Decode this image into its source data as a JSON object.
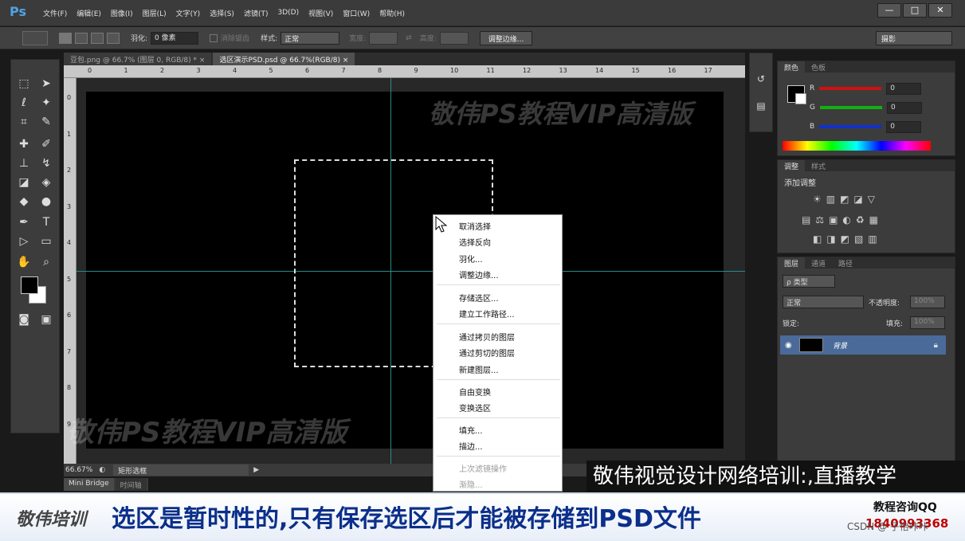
{
  "app": {
    "logo": "Ps",
    "menu": [
      "文件(F)",
      "编辑(E)",
      "图像(I)",
      "图层(L)",
      "文字(Y)",
      "选择(S)",
      "滤镜(T)",
      "3D(D)",
      "视图(V)",
      "窗口(W)",
      "帮助(H)"
    ],
    "window_controls": [
      "—",
      "□",
      "✕"
    ]
  },
  "options": {
    "feather_label": "羽化:",
    "feather_value": "0 像素",
    "antialias_label": "消除锯齿",
    "style_label": "样式:",
    "style_value": "正常",
    "width_label": "宽度:",
    "height_label": "高度:",
    "refine_button": "调整边缘...",
    "workspace": "摄影"
  },
  "tabs": [
    {
      "label": "豆包.png @ 66.7% (图层 0, RGB/8) *",
      "close": "×"
    },
    {
      "label": "选区演示PSD.psd @ 66.7%(RGB/8)",
      "close": "×"
    }
  ],
  "ruler": {
    "top": [
      "0",
      "1",
      "2",
      "3",
      "4",
      "5",
      "6",
      "7",
      "8",
      "9",
      "10",
      "11",
      "12",
      "13",
      "14",
      "15",
      "16",
      "17"
    ],
    "left": [
      "0",
      "1",
      "2",
      "3",
      "4",
      "5",
      "6",
      "7",
      "8",
      "9"
    ]
  },
  "canvas": {
    "watermark_top": "敬伟PS教程VIP高清版",
    "watermark_bottom": "敬伟PS教程VIP高清版"
  },
  "status": {
    "zoom": "66.67%",
    "doc_info": "矩形选框",
    "bottom_tabs": [
      "Mini Bridge",
      "时间轴"
    ]
  },
  "context_menu": {
    "groups": [
      [
        "取消选择",
        "选择反向",
        "羽化...",
        "调整边缘..."
      ],
      [
        "存储选区...",
        "建立工作路径..."
      ],
      [
        "通过拷贝的图层",
        "通过剪切的图层",
        "新建图层..."
      ],
      [
        "自由变换",
        "变换选区"
      ],
      [
        "填充...",
        "描边..."
      ]
    ],
    "disabled": [
      "上次滤镜操作",
      "渐隐..."
    ]
  },
  "panels": {
    "color": {
      "tabs": [
        "颜色",
        "色板"
      ],
      "r_label": "R",
      "g_label": "G",
      "b_label": "B",
      "r": "0",
      "g": "0",
      "b": "0",
      "colors": {
        "r": "#d01010",
        "g": "#10b010",
        "b": "#1030d0"
      }
    },
    "adjustments": {
      "tabs": [
        "调整",
        "样式"
      ],
      "title": "添加调整",
      "row1": "☀▥◩◪▽",
      "row2": "▤⚖▣◐♻▦",
      "row3": "◧◨◩▧▥"
    },
    "layers": {
      "tabs": [
        "图层",
        "通道",
        "路径"
      ],
      "filter": "ρ 类型",
      "blend": "正常",
      "opacity_label": "不透明度:",
      "opacity": "100%",
      "lock_label": "锁定:",
      "fill_label": "填充:",
      "fill": "100%",
      "layer_name": "背景"
    }
  },
  "overlay": {
    "subtitle": "敬伟视觉设计网络培训:,直播教学",
    "brand": "敬伟培训",
    "banner": "选区是暂时性的,只有保存选区后才能被存储到PSD文件",
    "consult": "教程咨询QQ",
    "qq": "1840993368",
    "csdn": "CSDN @ 子怡咔咔"
  }
}
